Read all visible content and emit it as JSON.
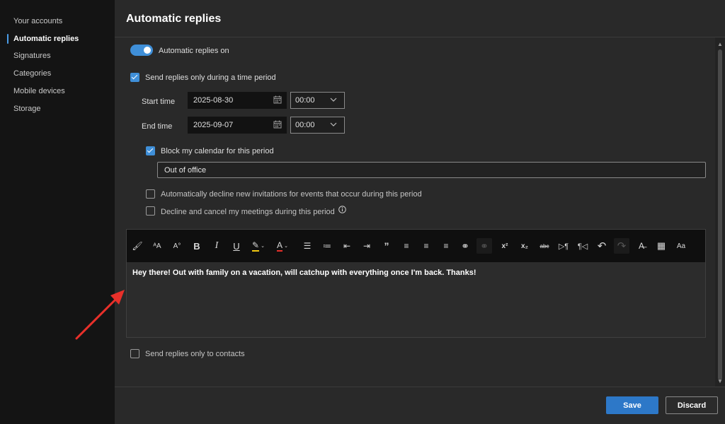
{
  "sidebar": {
    "items": [
      {
        "label": "Your accounts"
      },
      {
        "label": "Automatic replies"
      },
      {
        "label": "Signatures"
      },
      {
        "label": "Categories"
      },
      {
        "label": "Mobile devices"
      },
      {
        "label": "Storage"
      }
    ],
    "selected": "Automatic replies"
  },
  "page": {
    "title": "Automatic replies",
    "toggle_label": "Automatic replies on",
    "toggle_on": true,
    "time_period_label": "Send replies only during a time period",
    "time_period_checked": true,
    "start_label": "Start time",
    "start_date": "2025-08-30",
    "start_time": "00:00",
    "end_label": "End time",
    "end_date": "2025-09-07",
    "end_time": "00:00",
    "block_calendar_label": "Block my calendar for this period",
    "block_calendar_checked": true,
    "event_title_value": "Out of office",
    "decline_invites_label": "Automatically decline new invitations for events that occur during this period",
    "decline_invites_checked": false,
    "cancel_meetings_label": "Decline and cancel my meetings during this period",
    "cancel_meetings_checked": false,
    "message_body": "Hey there! Out with family on a vacation, will catchup with everything once I'm back. Thanks!",
    "contacts_only_label": "Send replies only to contacts",
    "contacts_only_checked": false
  },
  "toolbar": {
    "glyphs": {
      "format_painter": "🖌",
      "font_size_decrease": "ᴬA",
      "font_size_increase": "A°",
      "bold": "B",
      "italic": "I",
      "underline": "U",
      "highlight": "✎",
      "font_color": "A",
      "bullets": "☰",
      "numbering": "≔",
      "decrease_indent": "⇤",
      "increase_indent": "⇥",
      "quote": "”",
      "align_left": "≡",
      "align_center": "≡",
      "align_right": "≡",
      "link": "⚭",
      "unlink": "⚭",
      "superscript": "x²",
      "subscript": "x₂",
      "strikethrough": "abc",
      "ltr": "▷¶",
      "rtl": "¶◁",
      "undo": "↶",
      "redo": "↷",
      "clear_format": "A̶",
      "table": "▦",
      "styles": "Aa"
    }
  },
  "buttons": {
    "save": "Save",
    "discard": "Discard"
  },
  "colors": {
    "accent": "#3f8fd8",
    "annotation_arrow": "#e8302a"
  }
}
